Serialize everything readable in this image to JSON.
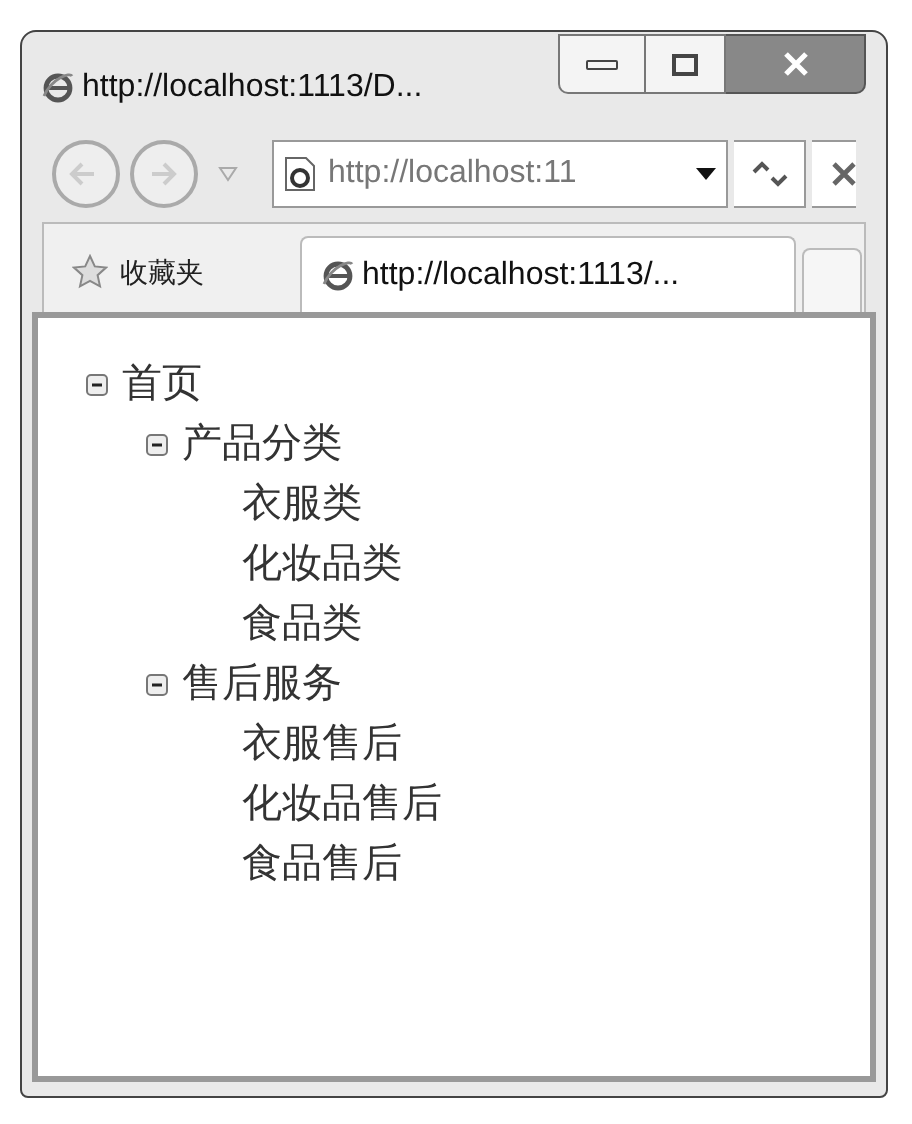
{
  "window": {
    "title": "http://localhost:1113/D..."
  },
  "address_bar": {
    "value": "http://localhost:11"
  },
  "favorites": {
    "label": "收藏夹"
  },
  "tabs": [
    {
      "label": "http://localhost:1113/...",
      "selected": true
    }
  ],
  "tree": [
    {
      "label": "首页",
      "expanded": true,
      "children": [
        {
          "label": "产品分类",
          "expanded": true,
          "children": [
            {
              "label": "衣服类"
            },
            {
              "label": "化妆品类"
            },
            {
              "label": "食品类"
            }
          ]
        },
        {
          "label": "售后服务",
          "expanded": true,
          "children": [
            {
              "label": "衣服售后"
            },
            {
              "label": "化妆品售后"
            },
            {
              "label": "食品售后"
            }
          ]
        }
      ]
    }
  ]
}
